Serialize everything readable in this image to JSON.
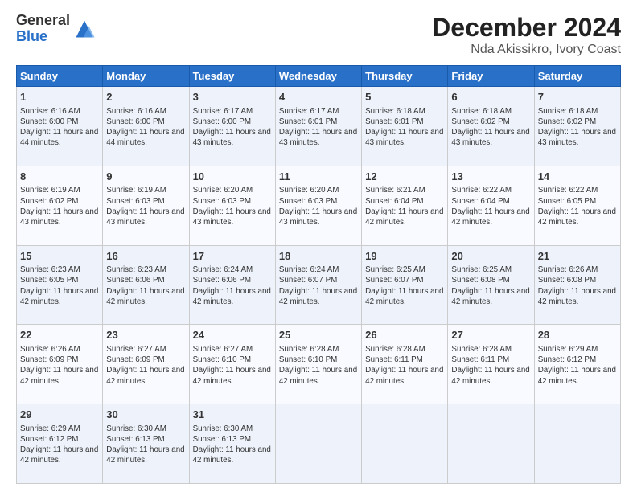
{
  "logo": {
    "line1": "General",
    "line2": "Blue"
  },
  "title": "December 2024",
  "subtitle": "Nda Akissikro, Ivory Coast",
  "days_of_week": [
    "Sunday",
    "Monday",
    "Tuesday",
    "Wednesday",
    "Thursday",
    "Friday",
    "Saturday"
  ],
  "weeks": [
    [
      {
        "day": 1,
        "info": "Sunrise: 6:16 AM\nSunset: 6:00 PM\nDaylight: 11 hours and 44 minutes."
      },
      {
        "day": 2,
        "info": "Sunrise: 6:16 AM\nSunset: 6:00 PM\nDaylight: 11 hours and 44 minutes."
      },
      {
        "day": 3,
        "info": "Sunrise: 6:17 AM\nSunset: 6:00 PM\nDaylight: 11 hours and 43 minutes."
      },
      {
        "day": 4,
        "info": "Sunrise: 6:17 AM\nSunset: 6:01 PM\nDaylight: 11 hours and 43 minutes."
      },
      {
        "day": 5,
        "info": "Sunrise: 6:18 AM\nSunset: 6:01 PM\nDaylight: 11 hours and 43 minutes."
      },
      {
        "day": 6,
        "info": "Sunrise: 6:18 AM\nSunset: 6:02 PM\nDaylight: 11 hours and 43 minutes."
      },
      {
        "day": 7,
        "info": "Sunrise: 6:18 AM\nSunset: 6:02 PM\nDaylight: 11 hours and 43 minutes."
      }
    ],
    [
      {
        "day": 8,
        "info": "Sunrise: 6:19 AM\nSunset: 6:02 PM\nDaylight: 11 hours and 43 minutes."
      },
      {
        "day": 9,
        "info": "Sunrise: 6:19 AM\nSunset: 6:03 PM\nDaylight: 11 hours and 43 minutes."
      },
      {
        "day": 10,
        "info": "Sunrise: 6:20 AM\nSunset: 6:03 PM\nDaylight: 11 hours and 43 minutes."
      },
      {
        "day": 11,
        "info": "Sunrise: 6:20 AM\nSunset: 6:03 PM\nDaylight: 11 hours and 43 minutes."
      },
      {
        "day": 12,
        "info": "Sunrise: 6:21 AM\nSunset: 6:04 PM\nDaylight: 11 hours and 42 minutes."
      },
      {
        "day": 13,
        "info": "Sunrise: 6:22 AM\nSunset: 6:04 PM\nDaylight: 11 hours and 42 minutes."
      },
      {
        "day": 14,
        "info": "Sunrise: 6:22 AM\nSunset: 6:05 PM\nDaylight: 11 hours and 42 minutes."
      }
    ],
    [
      {
        "day": 15,
        "info": "Sunrise: 6:23 AM\nSunset: 6:05 PM\nDaylight: 11 hours and 42 minutes."
      },
      {
        "day": 16,
        "info": "Sunrise: 6:23 AM\nSunset: 6:06 PM\nDaylight: 11 hours and 42 minutes."
      },
      {
        "day": 17,
        "info": "Sunrise: 6:24 AM\nSunset: 6:06 PM\nDaylight: 11 hours and 42 minutes."
      },
      {
        "day": 18,
        "info": "Sunrise: 6:24 AM\nSunset: 6:07 PM\nDaylight: 11 hours and 42 minutes."
      },
      {
        "day": 19,
        "info": "Sunrise: 6:25 AM\nSunset: 6:07 PM\nDaylight: 11 hours and 42 minutes."
      },
      {
        "day": 20,
        "info": "Sunrise: 6:25 AM\nSunset: 6:08 PM\nDaylight: 11 hours and 42 minutes."
      },
      {
        "day": 21,
        "info": "Sunrise: 6:26 AM\nSunset: 6:08 PM\nDaylight: 11 hours and 42 minutes."
      }
    ],
    [
      {
        "day": 22,
        "info": "Sunrise: 6:26 AM\nSunset: 6:09 PM\nDaylight: 11 hours and 42 minutes."
      },
      {
        "day": 23,
        "info": "Sunrise: 6:27 AM\nSunset: 6:09 PM\nDaylight: 11 hours and 42 minutes."
      },
      {
        "day": 24,
        "info": "Sunrise: 6:27 AM\nSunset: 6:10 PM\nDaylight: 11 hours and 42 minutes."
      },
      {
        "day": 25,
        "info": "Sunrise: 6:28 AM\nSunset: 6:10 PM\nDaylight: 11 hours and 42 minutes."
      },
      {
        "day": 26,
        "info": "Sunrise: 6:28 AM\nSunset: 6:11 PM\nDaylight: 11 hours and 42 minutes."
      },
      {
        "day": 27,
        "info": "Sunrise: 6:28 AM\nSunset: 6:11 PM\nDaylight: 11 hours and 42 minutes."
      },
      {
        "day": 28,
        "info": "Sunrise: 6:29 AM\nSunset: 6:12 PM\nDaylight: 11 hours and 42 minutes."
      }
    ],
    [
      {
        "day": 29,
        "info": "Sunrise: 6:29 AM\nSunset: 6:12 PM\nDaylight: 11 hours and 42 minutes."
      },
      {
        "day": 30,
        "info": "Sunrise: 6:30 AM\nSunset: 6:13 PM\nDaylight: 11 hours and 42 minutes."
      },
      {
        "day": 31,
        "info": "Sunrise: 6:30 AM\nSunset: 6:13 PM\nDaylight: 11 hours and 42 minutes."
      },
      null,
      null,
      null,
      null
    ]
  ]
}
